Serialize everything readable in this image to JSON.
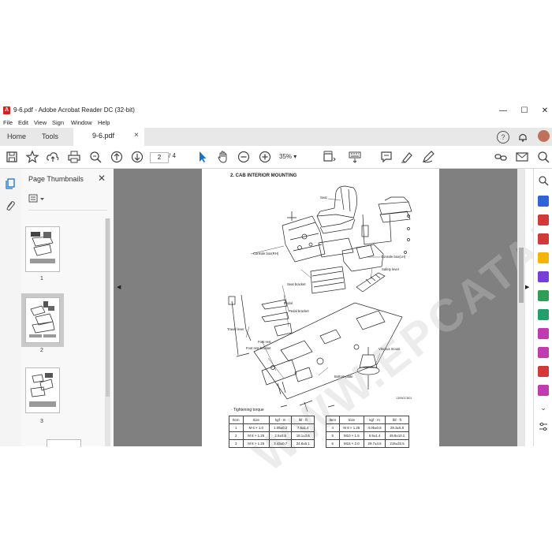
{
  "window": {
    "title": "9-6.pdf - Adobe Acrobat Reader DC (32-bit)",
    "controls": {
      "minimize": "—",
      "maximize": "☐",
      "close": "✕"
    }
  },
  "menu": [
    "File",
    "Edit",
    "View",
    "Sign",
    "Window",
    "Help"
  ],
  "tabs": {
    "home": "Home",
    "tools": "Tools",
    "document": "9-6.pdf",
    "close": "×"
  },
  "toolbar": {
    "current_page": "2",
    "total_pages": "/ 4",
    "zoom": "35%",
    "zoom_caret": "▾"
  },
  "thumbnails": {
    "header": "Page Thumbnails",
    "close": "✕",
    "pages": [
      {
        "number": "1",
        "selected": false
      },
      {
        "number": "2",
        "selected": true
      },
      {
        "number": "3",
        "selected": false
      }
    ]
  },
  "document": {
    "section_title": "2. CAB INTERIOR MOUNTING",
    "figure_code": "130W2CB01",
    "watermark": "WWW.EPCATALOG.COM",
    "labels": {
      "seat": "Seat",
      "console_box_rh": "Console box(RH)",
      "console_box_lh": "Console box(LH)",
      "safety_lever": "Safety lever",
      "seat_bracket": "Seat bracket",
      "pedal": "Pedal",
      "pedal_bracket": "Pedal bracket",
      "travel_lever": "Travel lever",
      "foot_rest": "Foot rest",
      "foot_rest_bracket": "Foot rest bracket",
      "viscous_mount": "Viscous mount",
      "bottom_plate": "Bottom plate"
    },
    "torque_title": "· Tightening torque",
    "torque_headers": [
      "Item",
      "Size",
      "kgf · m",
      "lbf · ft"
    ],
    "torque_left": [
      [
        "1",
        "M 6 × 1.0",
        "1.05±0.2",
        "7.6±1.4"
      ],
      [
        "2",
        "M 8 × 1.25",
        "2.5±0.5",
        "18.1±3.6"
      ],
      [
        "3",
        "M 8 × 1.25",
        "3.43±0.7",
        "24.8±5.1"
      ]
    ],
    "torque_right": [
      [
        "4",
        "M 8 × 1.25",
        "4.05±0.8",
        "29.3±5.8"
      ],
      [
        "5",
        "M10 × 1.5",
        "6.9±1.4",
        "49.9±10.1"
      ],
      [
        "6",
        "M16 × 2.0",
        "29.7±4.5",
        "215±32.5"
      ]
    ]
  },
  "colors": {
    "acrobat_red": "#d4211b",
    "doc_background": "#808080",
    "tab_bar": "#e8e8e8",
    "accent_blue": "#1a73c8"
  }
}
